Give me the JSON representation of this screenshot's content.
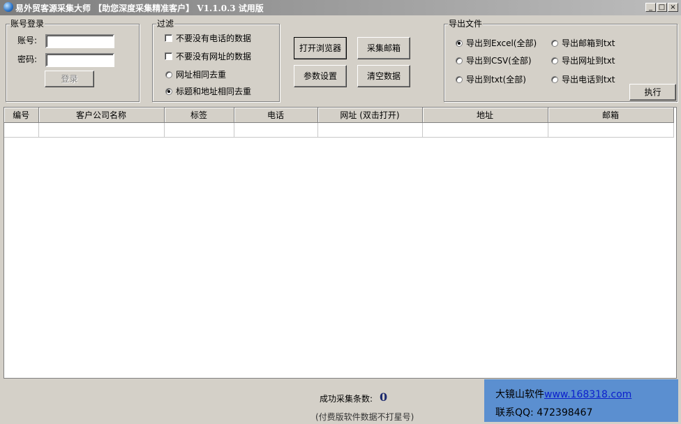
{
  "window": {
    "title": "易外贸客源采集大师 【助您深度采集精准客户】 V1.1.0.3 试用版",
    "buttons": [
      "_",
      "□",
      "×"
    ]
  },
  "login": {
    "legend": "账号登录",
    "account_label": "账号:",
    "account_value": "",
    "password_label": "密码:",
    "password_value": "",
    "login_button": "登录"
  },
  "filter": {
    "legend": "过滤",
    "options": [
      {
        "label": "不要没有电话的数据",
        "type": "checkbox",
        "checked": false
      },
      {
        "label": "不要没有网址的数据",
        "type": "checkbox",
        "checked": false
      },
      {
        "label": "网址相同去重",
        "type": "radio",
        "checked": false
      },
      {
        "label": "标题和地址相同去重",
        "type": "radio",
        "checked": true
      }
    ]
  },
  "actions": {
    "open_browser": "打开浏览器",
    "collect_email": "采集邮箱",
    "settings": "参数设置",
    "clear_data": "清空数据"
  },
  "export": {
    "legend": "导出文件",
    "options": [
      {
        "label": "导出到Excel(全部)",
        "checked": true
      },
      {
        "label": "导出邮箱到txt",
        "checked": false
      },
      {
        "label": "导出到CSV(全部)",
        "checked": false
      },
      {
        "label": "导出网址到txt",
        "checked": false
      },
      {
        "label": "导出到txt(全部)",
        "checked": false
      },
      {
        "label": "导出电话到txt",
        "checked": false
      }
    ],
    "execute_button": "执行"
  },
  "table": {
    "columns": [
      "编号",
      "客户公司名称",
      "标签",
      "电话",
      "网址 (双击打开)",
      "地址",
      "邮箱"
    ],
    "rows": []
  },
  "status": {
    "count_label": "成功采集条数:",
    "count": "0",
    "note": "(付费版软件数据不打星号)"
  },
  "ad": {
    "company": "大镜山软件",
    "url": "www.168318.com",
    "qq": "联系QQ: 472398467"
  },
  "colors": {
    "window_bg": "#d4d0c8",
    "ad_bg": "#5b8fd0",
    "link": "#0b1fcc",
    "count": "#1c2a6e"
  }
}
